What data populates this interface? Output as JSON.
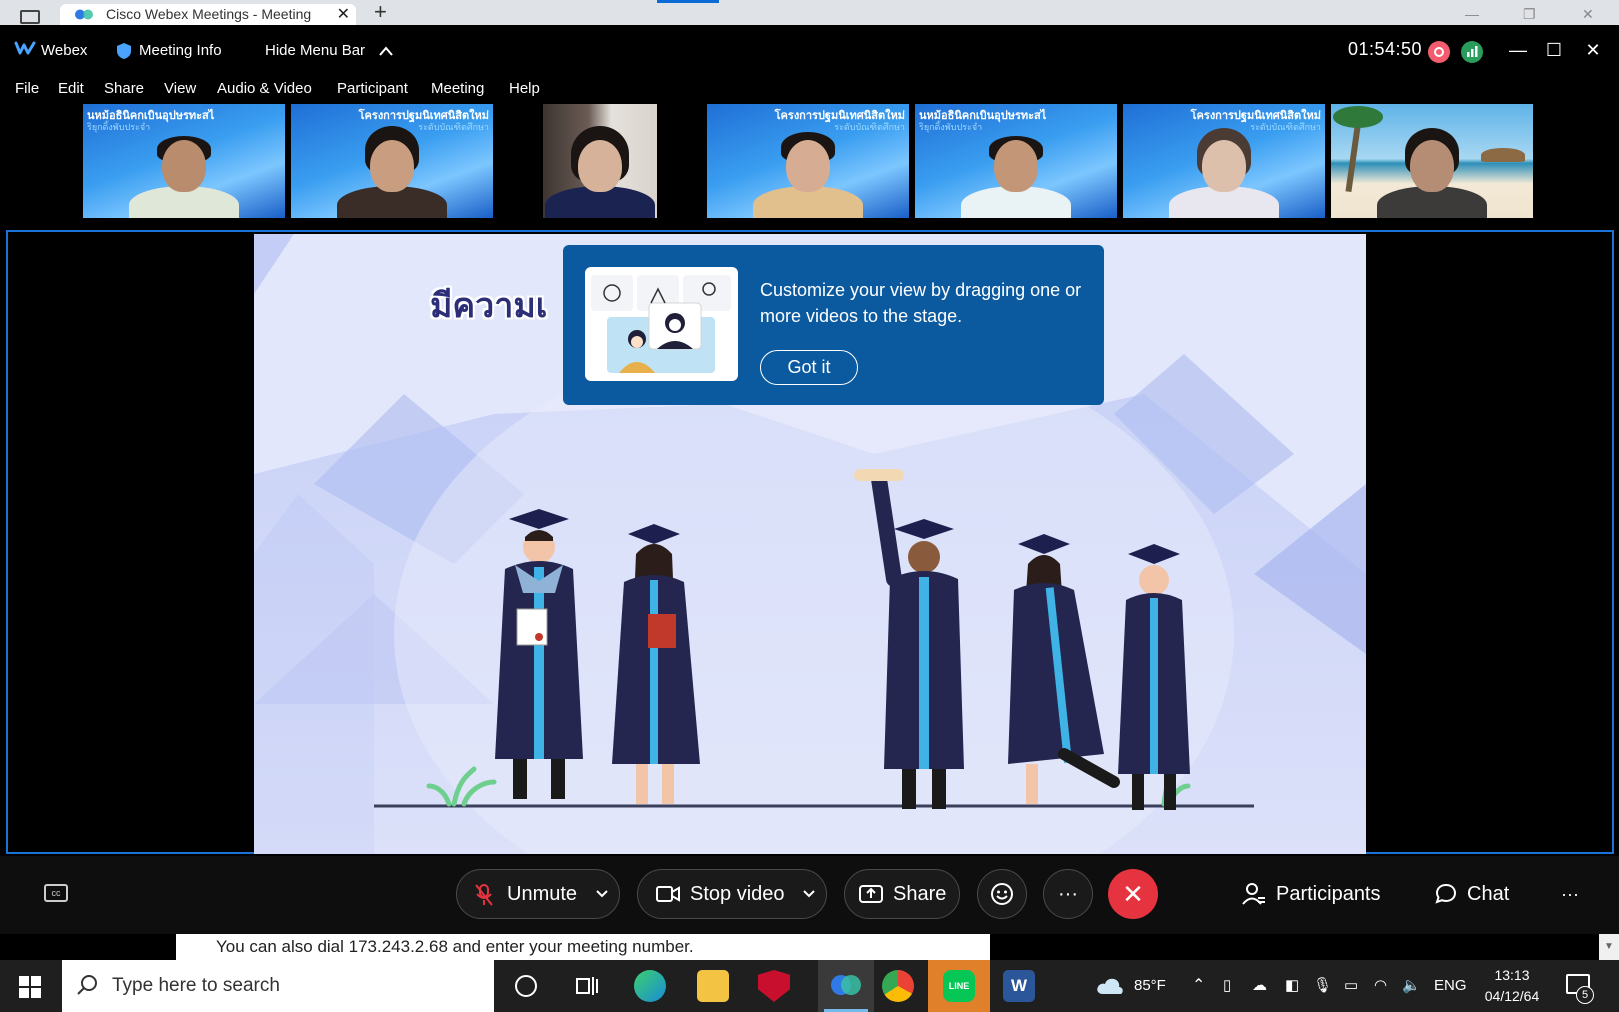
{
  "browser": {
    "tab_title": "Cisco Webex Meetings - Meeting",
    "new_tab": "+",
    "close_tab": "✕"
  },
  "titlebar": {
    "app_name": "Webex",
    "meeting_info": "Meeting Info",
    "hide_menu_bar": "Hide Menu Bar",
    "timer": "01:54:50"
  },
  "menu": [
    "File",
    "Edit",
    "Share",
    "View",
    "Audio & Video",
    "Participant",
    "Meeting",
    "Help"
  ],
  "filmstrip": [
    {
      "bg": "blue",
      "banner": "นหม้อธินิคกเบินอุปษรทะสไ",
      "banner2": "ริยุกดิ้งพับประจำ"
    },
    {
      "bg": "blue",
      "banner": "โครงการปฐมนิเทศนิสิตใหม่",
      "banner2": "ระดับบัณฑิตศึกษา"
    },
    {
      "bg": "room",
      "banner": "",
      "banner2": ""
    },
    {
      "bg": "blue",
      "banner": "โครงการปฐมนิเทศนิสิตใหม่",
      "banner2": "ระดับบัณฑิตศึกษา"
    },
    {
      "bg": "blue",
      "banner": "นหม้อธินิคกเบินอุปษรทะสไ",
      "banner2": "ริยุกดิ้งพับประจำ"
    },
    {
      "bg": "blue",
      "banner": "โครงการปฐมนิเทศนิสิตใหม่",
      "banner2": "ระดับบัณฑิตศึกษา"
    },
    {
      "bg": "beach",
      "banner": "",
      "banner2": ""
    }
  ],
  "slide": {
    "title": "มีความเ"
  },
  "tooltip": {
    "text": "Customize your view by dragging one or more videos to the stage.",
    "button": "Got it"
  },
  "controls": {
    "unmute": "Unmute",
    "stop_video": "Stop video",
    "share": "Share",
    "more": "···",
    "end": "✕",
    "participants": "Participants",
    "chat": "Chat",
    "overflow": "···"
  },
  "dial_note": "You can also dial 173.243.2.68 and enter your meeting number.",
  "taskbar": {
    "search_placeholder": "Type here to search",
    "weather": "85°F",
    "language": "ENG",
    "time": "13:13",
    "date": "04/12/64",
    "notifications": "5"
  },
  "colors": {
    "accent_blue": "#1b73d8",
    "tooltip_bg": "#0b5aa0",
    "end_red": "#e5333f",
    "record_red": "#f35c6e",
    "network_green": "#2a9d5c"
  }
}
